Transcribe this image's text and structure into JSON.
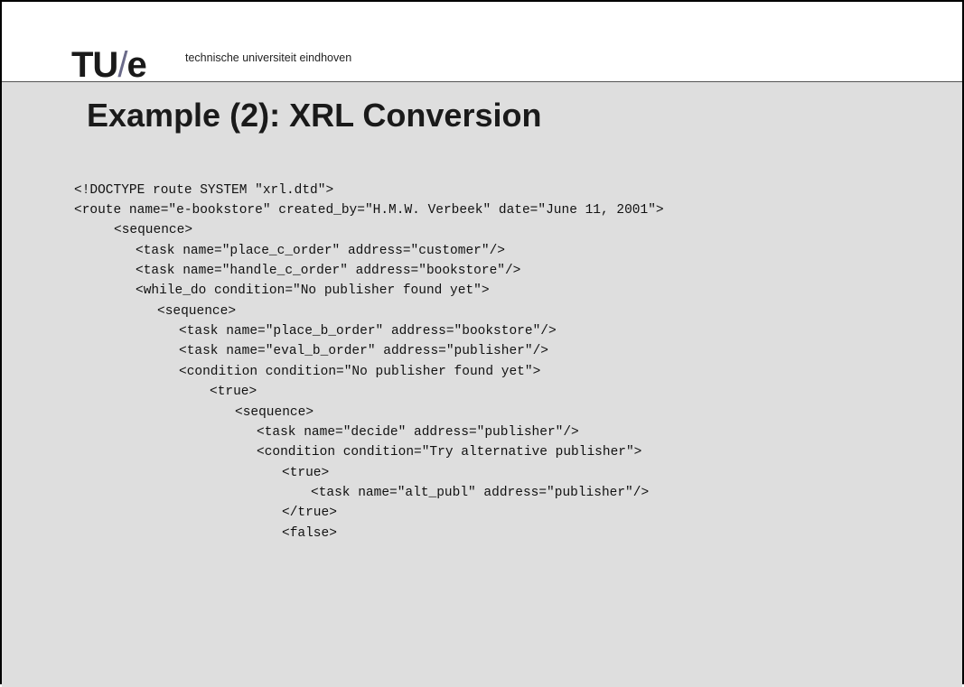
{
  "header": {
    "logo_main": "TU",
    "logo_slash": "/",
    "logo_e": "e",
    "university": "technische universiteit eindhoven"
  },
  "slide": {
    "title": "Example (2): XRL Conversion",
    "code_lines": [
      "<!DOCTYPE route SYSTEM \"xrl.dtd\">",
      "<route name=\"e-bookstore\" created_by=\"H.M.W. Verbeek\" date=\"June 11, 2001\">",
      "<sequence>",
      "<task name=\"place_c_order\" address=\"customer\"/>",
      "<task name=\"handle_c_order\" address=\"bookstore\"/>",
      "<while_do condition=\"No publisher found yet\">",
      "<sequence>",
      "<task name=\"place_b_order\" address=\"bookstore\"/>",
      "<task name=\"eval_b_order\" address=\"publisher\"/>",
      "<condition condition=\"No publisher found yet\">",
      "<true>",
      "<sequence>",
      "<task name=\"decide\" address=\"publisher\"/>",
      "<condition condition=\"Try alternative publisher\">",
      "<true>",
      "<task name=\"alt_publ\" address=\"publisher\"/>",
      "</true>",
      "<false>"
    ]
  }
}
